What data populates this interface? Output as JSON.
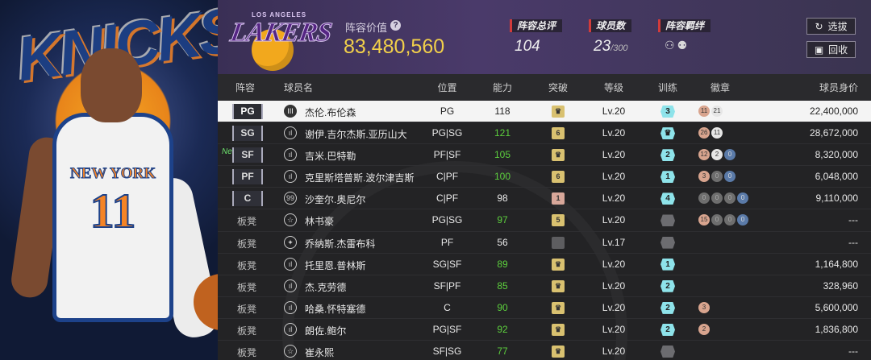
{
  "header": {
    "team_logo_word": "LAKERS",
    "team_logo_city": "LOS ANGELES",
    "value_label": "阵容价值",
    "value": "83,480,560",
    "stats": [
      {
        "label": "阵容总评",
        "value": "104"
      },
      {
        "label": "球员数",
        "value": "23",
        "suffix": "/300"
      },
      {
        "label": "阵容羁绊"
      }
    ],
    "buttons": {
      "select": "选拔",
      "recycle": "回收"
    }
  },
  "player_art": {
    "jersey_text": "NEW YORK",
    "jersey_number": "11",
    "logo_word": "KNICKS"
  },
  "table": {
    "headers": {
      "lineup": "阵容",
      "name": "球员名",
      "position": "位置",
      "ability": "能力",
      "breakthrough": "突破",
      "level": "等级",
      "training": "训练",
      "badges": "徽章",
      "value": "球员身价"
    },
    "rows": [
      {
        "slot": "PG",
        "starter": true,
        "selected": true,
        "icon": "III",
        "name": "杰伦.布伦森",
        "pos": "PG",
        "ability": "118",
        "ability_color": "white",
        "brk": {
          "type": "gold",
          "text": "♛"
        },
        "level": "Lv.20",
        "training": {
          "type": "cyan",
          "text": "3"
        },
        "badges": [
          {
            "t": "11",
            "c": "br"
          },
          {
            "t": "21",
            "c": "si"
          }
        ],
        "value": "22,400,000"
      },
      {
        "slot": "SG",
        "starter": true,
        "icon": "ıl",
        "name": "谢伊.吉尔杰斯.亚历山大",
        "pos": "PG|SG",
        "ability": "121",
        "ability_color": "green",
        "brk": {
          "type": "gold",
          "text": "6"
        },
        "level": "Lv.20",
        "training": {
          "type": "cyan",
          "text": "♛"
        },
        "badges": [
          {
            "t": "26",
            "c": "br"
          },
          {
            "t": "11",
            "c": "si"
          }
        ],
        "value": "28,672,000"
      },
      {
        "slot": "SF",
        "starter": true,
        "new": "New",
        "icon": "ıl",
        "name": "吉米.巴特勒",
        "pos": "PF|SF",
        "ability": "105",
        "ability_color": "green",
        "brk": {
          "type": "gold",
          "text": "♛"
        },
        "level": "Lv.20",
        "training": {
          "type": "cyan",
          "text": "2"
        },
        "badges": [
          {
            "t": "12",
            "c": "br"
          },
          {
            "t": "2",
            "c": "si"
          },
          {
            "t": "0",
            "c": "bl"
          }
        ],
        "value": "8,320,000"
      },
      {
        "slot": "PF",
        "starter": true,
        "icon": "ıl",
        "name": "克里斯塔普斯.波尔津吉斯",
        "pos": "C|PF",
        "ability": "100",
        "ability_color": "green",
        "brk": {
          "type": "gold",
          "text": "6"
        },
        "level": "Lv.20",
        "training": {
          "type": "cyan",
          "text": "1"
        },
        "badges": [
          {
            "t": "3",
            "c": "br"
          },
          {
            "t": "0",
            "c": "gr"
          },
          {
            "t": "0",
            "c": "bl"
          }
        ],
        "value": "6,048,000"
      },
      {
        "slot": "C",
        "starter": true,
        "icon": "99",
        "name": "沙奎尔.奥尼尔",
        "pos": "C|PF",
        "ability": "98",
        "ability_color": "white",
        "brk": {
          "type": "pink",
          "text": "1"
        },
        "level": "Lv.20",
        "training": {
          "type": "cyan",
          "text": "4"
        },
        "badges": [
          {
            "t": "0",
            "c": "gr"
          },
          {
            "t": "0",
            "c": "gr"
          },
          {
            "t": "0",
            "c": "gr"
          },
          {
            "t": "0",
            "c": "bl"
          }
        ],
        "value": "9,110,000"
      },
      {
        "slot": "板凳",
        "starter": false,
        "icon": "☆",
        "name": "林书豪",
        "pos": "PG|SG",
        "ability": "97",
        "ability_color": "green",
        "brk": {
          "type": "gold",
          "text": "5"
        },
        "level": "Lv.20",
        "training": {
          "type": "gray",
          "text": ""
        },
        "badges": [
          {
            "t": "15",
            "c": "br"
          },
          {
            "t": "0",
            "c": "gr"
          },
          {
            "t": "0",
            "c": "gr"
          },
          {
            "t": "0",
            "c": "bl"
          }
        ],
        "value": "---"
      },
      {
        "slot": "板凳",
        "starter": false,
        "icon": "✦",
        "name": "乔纳斯.杰雷布科",
        "pos": "PF",
        "ability": "56",
        "ability_color": "white",
        "brk": {
          "type": "gray",
          "text": ""
        },
        "level": "Lv.17",
        "training": {
          "type": "gray",
          "text": ""
        },
        "badges": [],
        "value": "---"
      },
      {
        "slot": "板凳",
        "starter": false,
        "icon": "ıl",
        "name": "托里恩.普林斯",
        "pos": "SG|SF",
        "ability": "89",
        "ability_color": "green",
        "brk": {
          "type": "gold",
          "text": "♛"
        },
        "level": "Lv.20",
        "training": {
          "type": "cyan",
          "text": "1"
        },
        "badges": [],
        "value": "1,164,800"
      },
      {
        "slot": "板凳",
        "starter": false,
        "icon": "ıl",
        "name": "杰.克劳德",
        "pos": "SF|PF",
        "ability": "85",
        "ability_color": "green",
        "brk": {
          "type": "gold",
          "text": "♛"
        },
        "level": "Lv.20",
        "training": {
          "type": "cyan",
          "text": "2"
        },
        "badges": [],
        "value": "328,960"
      },
      {
        "slot": "板凳",
        "starter": false,
        "icon": "ıl",
        "name": "哈桑.怀特塞德",
        "pos": "C",
        "ability": "90",
        "ability_color": "green",
        "brk": {
          "type": "gold",
          "text": "♛"
        },
        "level": "Lv.20",
        "training": {
          "type": "cyan",
          "text": "2"
        },
        "badges": [
          {
            "t": "3",
            "c": "br"
          }
        ],
        "value": "5,600,000"
      },
      {
        "slot": "板凳",
        "starter": false,
        "icon": "ıl",
        "name": "朗佐.鲍尔",
        "pos": "PG|SF",
        "ability": "92",
        "ability_color": "green",
        "brk": {
          "type": "gold",
          "text": "♛"
        },
        "level": "Lv.20",
        "training": {
          "type": "cyan",
          "text": "2"
        },
        "badges": [
          {
            "t": "2",
            "c": "br"
          }
        ],
        "value": "1,836,800"
      },
      {
        "slot": "板凳",
        "starter": false,
        "icon": "☆",
        "name": "崔永熙",
        "pos": "SF|SG",
        "ability": "77",
        "ability_color": "green",
        "brk": {
          "type": "gold",
          "text": "♛"
        },
        "level": "Lv.20",
        "training": {
          "type": "gray",
          "text": ""
        },
        "badges": [],
        "value": "---"
      }
    ]
  }
}
